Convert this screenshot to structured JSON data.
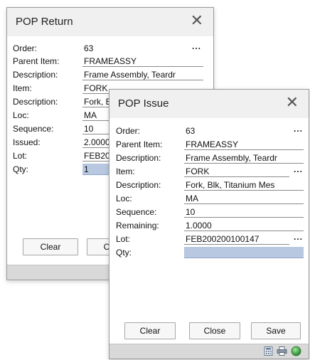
{
  "return_dialog": {
    "title": "POP Return",
    "close_glyph": "✕",
    "fields": {
      "order_label": "Order:",
      "order_value": "63",
      "parent_label": "Parent Item:",
      "parent_value": "FRAMEASSY",
      "desc_label": "Description:",
      "desc_value": "Frame Assembly, Teardr",
      "item_label": "Item:",
      "item_value": "FORK",
      "desc2_label": "Description:",
      "desc2_value": "Fork, Blk, Titanium Mes",
      "loc_label": "Loc:",
      "loc_value": "MA",
      "seq_label": "Sequence:",
      "seq_value": "10",
      "issued_label": "Issued:",
      "issued_value": "2.0000",
      "lot_label": "Lot:",
      "lot_value": "FEB200200100147",
      "qty_label": "Qty:",
      "qty_value": "1"
    },
    "dots": "...",
    "buttons": {
      "clear": "Clear",
      "close": "Close"
    }
  },
  "issue_dialog": {
    "title": "POP Issue",
    "close_glyph": "✕",
    "fields": {
      "order_label": "Order:",
      "order_value": "63",
      "parent_label": "Parent Item:",
      "parent_value": "FRAMEASSY",
      "desc_label": "Description:",
      "desc_value": "Frame Assembly, Teardr",
      "item_label": "Item:",
      "item_value": "FORK",
      "desc2_label": "Description:",
      "desc2_value": "Fork, Blk, Titanium Mes",
      "loc_label": "Loc:",
      "loc_value": "MA",
      "seq_label": "Sequence:",
      "seq_value": "10",
      "remaining_label": "Remaining:",
      "remaining_value": "1.0000",
      "lot_label": "Lot:",
      "lot_value": "FEB200200100147",
      "qty_label": "Qty:",
      "qty_value": ""
    },
    "dots": "...",
    "buttons": {
      "clear": "Clear",
      "close": "Close",
      "save": "Save"
    },
    "status_icons": [
      "calculator-icon",
      "printer-icon",
      "green-status-icon"
    ]
  },
  "colors": {
    "qty_fill": "#b8c8e0",
    "status_green": "#3aa43a"
  }
}
